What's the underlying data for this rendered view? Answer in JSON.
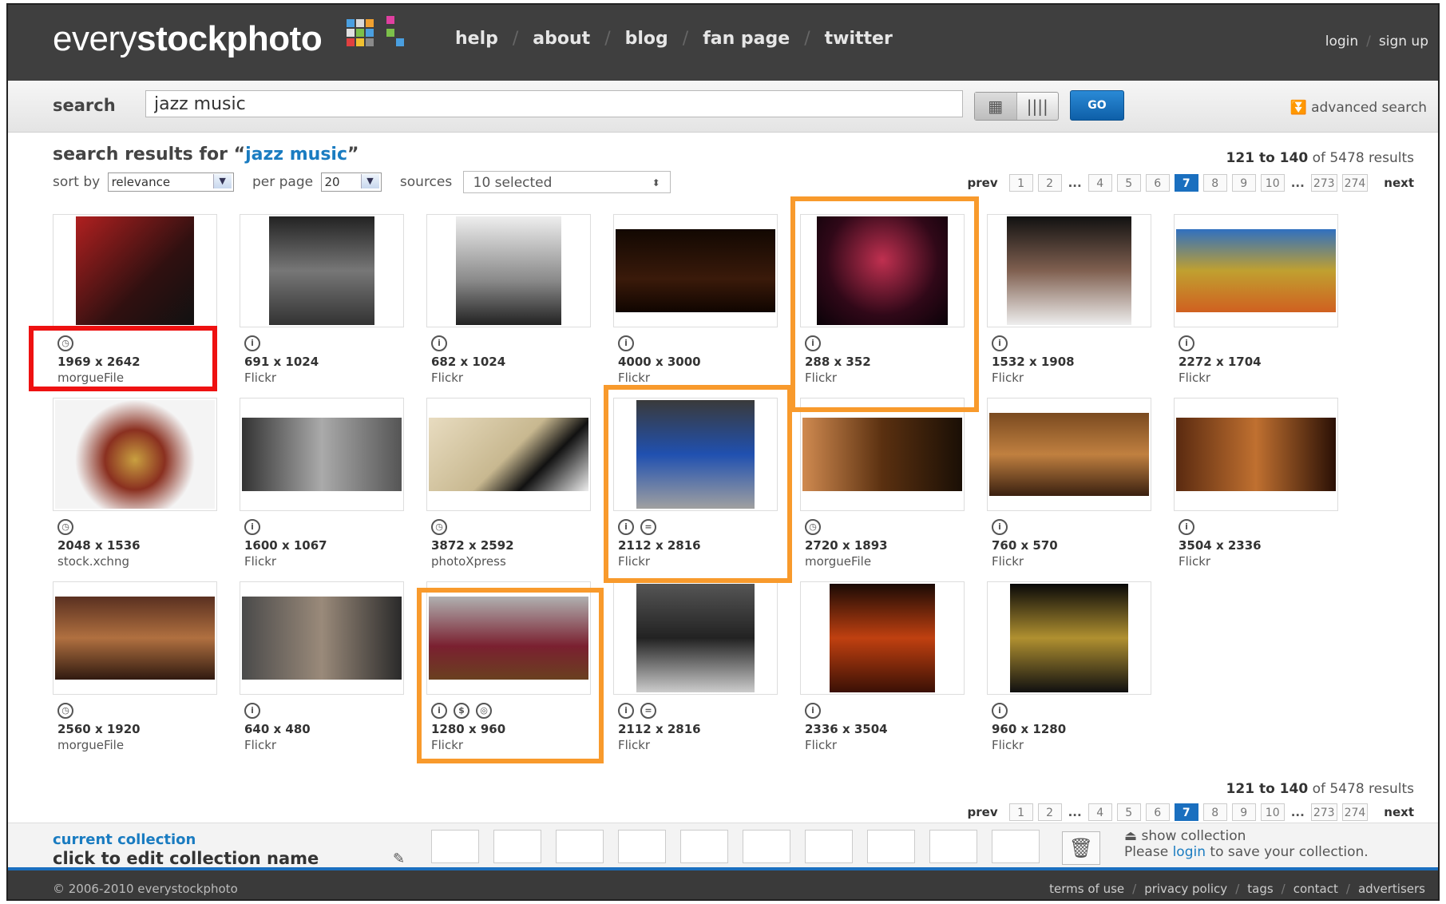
{
  "logo": {
    "prefix": "every",
    "bold": "stockphoto"
  },
  "nav": [
    "help",
    "about",
    "blog",
    "fan page",
    "twitter"
  ],
  "account": {
    "login": "login",
    "signup": "sign up"
  },
  "search": {
    "label": "search",
    "value": "jazz music",
    "go": "GO",
    "advanced": "advanced search"
  },
  "results": {
    "heading_prefix": "search results for ",
    "query": "jazz music",
    "range": "121 to 140",
    "total": "of 5478 results",
    "sort_label": "sort by",
    "sort_value": "relevance",
    "perpage_label": "per page",
    "perpage_value": "20",
    "sources_label": "sources",
    "sources_value": "10 selected"
  },
  "pager": {
    "prev": "prev",
    "next": "next",
    "pages": [
      "1",
      "2",
      "...",
      "4",
      "5",
      "6",
      "7",
      "8",
      "9",
      "10",
      "...",
      "273",
      "274"
    ],
    "current": "7"
  },
  "photos": [
    {
      "dims": "1969 x 2642",
      "source": "morgueFile",
      "licenses": [
        "clock-icon"
      ]
    },
    {
      "dims": "691 x 1024",
      "source": "Flickr",
      "licenses": [
        "attribution-icon"
      ]
    },
    {
      "dims": "682 x 1024",
      "source": "Flickr",
      "licenses": [
        "attribution-icon"
      ]
    },
    {
      "dims": "4000 x 3000",
      "source": "Flickr",
      "licenses": [
        "attribution-icon"
      ]
    },
    {
      "dims": "288 x 352",
      "source": "Flickr",
      "licenses": [
        "attribution-icon"
      ]
    },
    {
      "dims": "1532 x 1908",
      "source": "Flickr",
      "licenses": [
        "attribution-icon"
      ]
    },
    {
      "dims": "2272 x 1704",
      "source": "Flickr",
      "licenses": [
        "attribution-icon"
      ]
    },
    {
      "dims": "2048 x 1536",
      "source": "stock.xchng",
      "licenses": [
        "clock-icon"
      ]
    },
    {
      "dims": "1600 x 1067",
      "source": "Flickr",
      "licenses": [
        "attribution-icon"
      ]
    },
    {
      "dims": "3872 x 2592",
      "source": "photoXpress",
      "licenses": [
        "clock-icon"
      ]
    },
    {
      "dims": "2112 x 2816",
      "source": "Flickr",
      "licenses": [
        "attribution-icon",
        "noderivs-icon"
      ]
    },
    {
      "dims": "2720 x 1893",
      "source": "morgueFile",
      "licenses": [
        "clock-icon"
      ]
    },
    {
      "dims": "760 x 570",
      "source": "Flickr",
      "licenses": [
        "attribution-icon"
      ]
    },
    {
      "dims": "3504 x 2336",
      "source": "Flickr",
      "licenses": [
        "attribution-icon"
      ]
    },
    {
      "dims": "2560 x 1920",
      "source": "morgueFile",
      "licenses": [
        "clock-icon"
      ]
    },
    {
      "dims": "640 x 480",
      "source": "Flickr",
      "licenses": [
        "attribution-icon"
      ]
    },
    {
      "dims": "1280 x 960",
      "source": "Flickr",
      "licenses": [
        "attribution-icon",
        "noncommercial-icon",
        "sharealike-icon"
      ]
    },
    {
      "dims": "2112 x 2816",
      "source": "Flickr",
      "licenses": [
        "attribution-icon",
        "noderivs-icon"
      ]
    },
    {
      "dims": "2336 x 3504",
      "source": "Flickr",
      "licenses": [
        "attribution-icon"
      ]
    },
    {
      "dims": "960 x 1280",
      "source": "Flickr",
      "licenses": [
        "attribution-icon"
      ]
    }
  ],
  "collection": {
    "title": "current collection",
    "edit": "click to edit collection name",
    "show": "show collection",
    "save_prefix": "Please ",
    "save_link": "login",
    "save_suffix": " to save your collection."
  },
  "footer": {
    "copyright": "© 2006-2010 everystockphoto",
    "links": [
      "terms of use",
      "privacy policy",
      "tags",
      "contact",
      "advertisers"
    ]
  },
  "colors": {
    "accent": "#1a7cc1",
    "highlight_red": "#e11111",
    "highlight_orange": "#f89a2c"
  }
}
